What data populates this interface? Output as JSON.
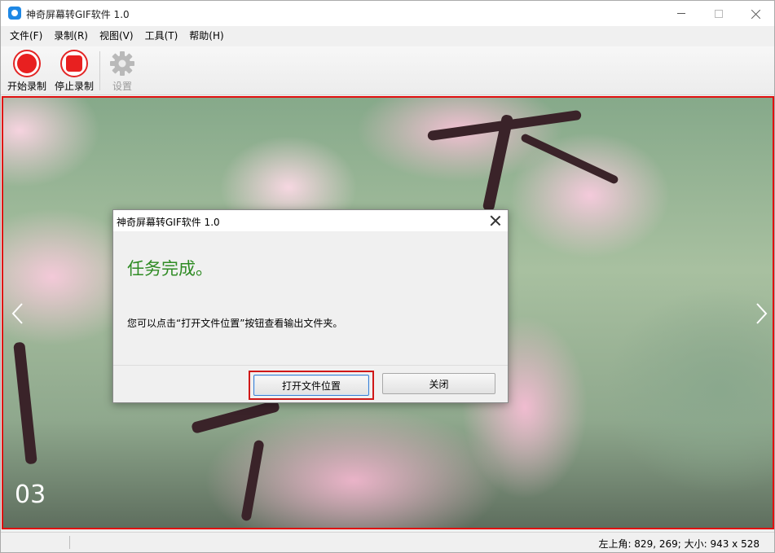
{
  "window": {
    "title": "神奇屏幕转GIF软件 1.0",
    "controls": {
      "minimize": "minimize",
      "maximize": "maximize",
      "close": "close"
    }
  },
  "menu": {
    "items": [
      {
        "label": "文件(F)"
      },
      {
        "label": "录制(R)"
      },
      {
        "label": "视图(V)"
      },
      {
        "label": "工具(T)"
      },
      {
        "label": "帮助(H)"
      }
    ]
  },
  "toolbar": {
    "start_label": "开始录制",
    "stop_label": "停止录制",
    "settings_label": "设置",
    "settings_enabled": false
  },
  "capture": {
    "slide_number": "03",
    "border_color": "#e01010"
  },
  "dialog": {
    "title": "神奇屏幕转GIF软件 1.0",
    "heading": "任务完成。",
    "message": "您可以点击“打开文件位置”按钮查看输出文件夹。",
    "open_button": "打开文件位置",
    "close_button": "关闭",
    "heading_color": "#2f8b24"
  },
  "status": {
    "text": "左上角: 829, 269; 大小: 943 x 528"
  },
  "icons": [
    "app-icon",
    "record-start-icon",
    "record-stop-icon",
    "gear-icon",
    "close-icon",
    "chevron-left-icon",
    "chevron-right-icon"
  ]
}
